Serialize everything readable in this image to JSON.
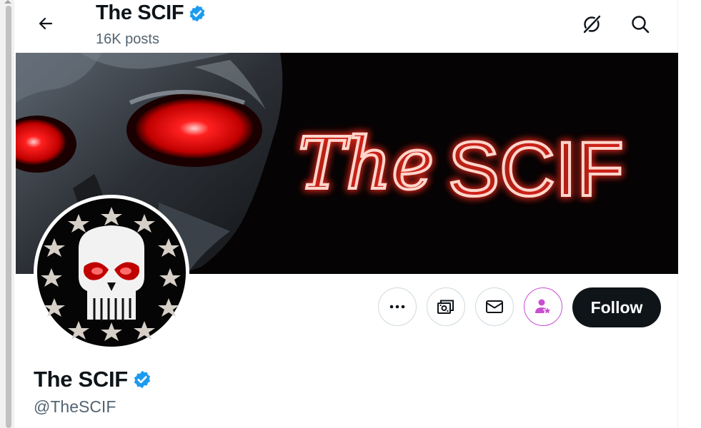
{
  "header": {
    "title": "The SCIF",
    "post_count": "16K posts"
  },
  "banner": {
    "neon_text_script": "The",
    "neon_text_block": "SCIF",
    "colors": {
      "neon": "#ff5a4a",
      "eyes": "#ff1010",
      "background": "#050304"
    }
  },
  "profile": {
    "display_name": "The SCIF",
    "handle": "@TheSCIF",
    "verified": true
  },
  "actions": {
    "more_icon": "more-dots-icon",
    "subscribe_icon": "money-stack-icon",
    "message_icon": "envelope-icon",
    "subscribe_user_icon": "person-star-icon",
    "follow_label": "Follow"
  },
  "icons": {
    "back": "back-arrow-icon",
    "grok": "grok-icon",
    "search": "search-icon",
    "verified": "verified-badge-icon"
  },
  "colors": {
    "verified_blue": "#1d9bf0",
    "follow_bg": "#0f1419",
    "secondary_text": "#536471",
    "subscribe_accent": "#c94fd0"
  }
}
